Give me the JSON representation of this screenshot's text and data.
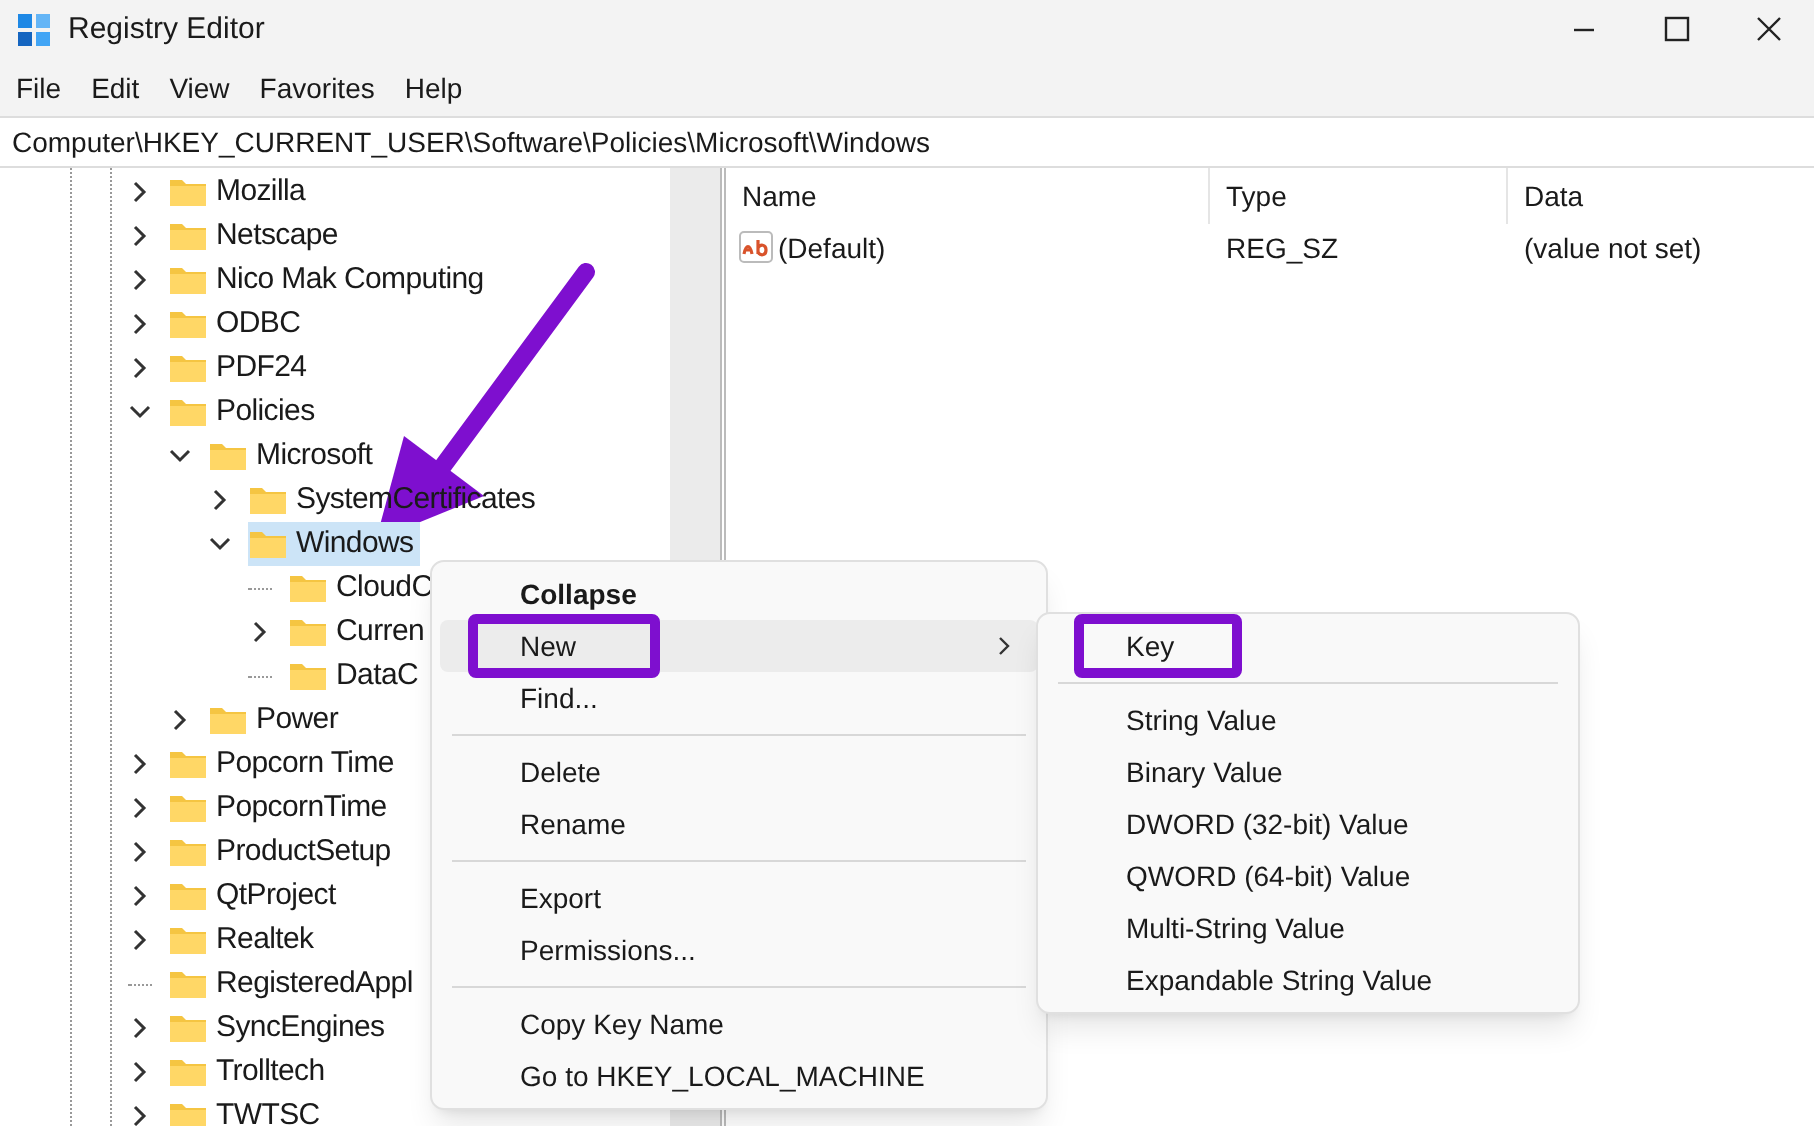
{
  "window": {
    "title": "Registry Editor"
  },
  "menu_bar": [
    "File",
    "Edit",
    "View",
    "Favorites",
    "Help"
  ],
  "address": "Computer\\HKEY_CURRENT_USER\\Software\\Policies\\Microsoft\\Windows",
  "tree": [
    {
      "label": "Mozilla",
      "expandable": true,
      "expanded": false,
      "selected": false
    },
    {
      "label": "Netscape",
      "expandable": true,
      "expanded": false,
      "selected": false
    },
    {
      "label": "Nico Mak Computing",
      "expandable": true,
      "expanded": false,
      "selected": false
    },
    {
      "label": "ODBC",
      "expandable": true,
      "expanded": false,
      "selected": false
    },
    {
      "label": "PDF24",
      "expandable": true,
      "expanded": false,
      "selected": false
    },
    {
      "label": "Policies",
      "expandable": true,
      "expanded": true,
      "selected": false,
      "children": [
        {
          "label": "Microsoft",
          "expandable": true,
          "expanded": true,
          "selected": false,
          "children": [
            {
              "label": "SystemCertificates",
              "expandable": true,
              "expanded": false,
              "selected": false
            },
            {
              "label": "Windows",
              "expandable": true,
              "expanded": true,
              "selected": true,
              "children": [
                {
                  "label": "CloudC",
                  "expandable": false,
                  "selected": false
                },
                {
                  "label": "Curren",
                  "expandable": true,
                  "expanded": false,
                  "selected": false
                },
                {
                  "label": "DataC",
                  "expandable": false,
                  "selected": false
                }
              ]
            }
          ]
        },
        {
          "label": "Power",
          "expandable": true,
          "expanded": false,
          "selected": false
        }
      ]
    },
    {
      "label": "Popcorn Time",
      "expandable": true,
      "expanded": false,
      "selected": false
    },
    {
      "label": "PopcornTime",
      "expandable": true,
      "expanded": false,
      "selected": false
    },
    {
      "label": "ProductSetup",
      "expandable": true,
      "expanded": false,
      "selected": false
    },
    {
      "label": "QtProject",
      "expandable": true,
      "expanded": false,
      "selected": false
    },
    {
      "label": "Realtek",
      "expandable": true,
      "expanded": false,
      "selected": false
    },
    {
      "label": "RegisteredAppl",
      "expandable": false,
      "selected": false
    },
    {
      "label": "SyncEngines",
      "expandable": true,
      "expanded": false,
      "selected": false
    },
    {
      "label": "Trolltech",
      "expandable": true,
      "expanded": false,
      "selected": false
    },
    {
      "label": "TWTSC",
      "expandable": true,
      "expanded": false,
      "selected": false
    }
  ],
  "values": {
    "columns": [
      "Name",
      "Type",
      "Data"
    ],
    "rows": [
      {
        "name": "(Default)",
        "type": "REG_SZ",
        "data": "(value not set)"
      }
    ]
  },
  "context_menu": [
    {
      "kind": "item",
      "label": "Collapse",
      "bold": true,
      "hovered": false,
      "submenu": false,
      "annotated": false
    },
    {
      "kind": "item",
      "label": "New",
      "bold": false,
      "hovered": true,
      "submenu": true,
      "annotated": true
    },
    {
      "kind": "item",
      "label": "Find...",
      "bold": false,
      "hovered": false,
      "submenu": false,
      "annotated": false
    },
    {
      "kind": "separator"
    },
    {
      "kind": "item",
      "label": "Delete",
      "bold": false,
      "hovered": false,
      "submenu": false,
      "annotated": false
    },
    {
      "kind": "item",
      "label": "Rename",
      "bold": false,
      "hovered": false,
      "submenu": false,
      "annotated": false
    },
    {
      "kind": "separator"
    },
    {
      "kind": "item",
      "label": "Export",
      "bold": false,
      "hovered": false,
      "submenu": false,
      "annotated": false
    },
    {
      "kind": "item",
      "label": "Permissions...",
      "bold": false,
      "hovered": false,
      "submenu": false,
      "annotated": false
    },
    {
      "kind": "separator"
    },
    {
      "kind": "item",
      "label": "Copy Key Name",
      "bold": false,
      "hovered": false,
      "submenu": false,
      "annotated": false
    },
    {
      "kind": "item",
      "label": "Go to HKEY_LOCAL_MACHINE",
      "bold": false,
      "hovered": false,
      "submenu": false,
      "annotated": false
    }
  ],
  "submenu": [
    {
      "kind": "item",
      "label": "Key",
      "annotated": true
    },
    {
      "kind": "separator"
    },
    {
      "kind": "item",
      "label": "String Value",
      "annotated": false
    },
    {
      "kind": "item",
      "label": "Binary Value",
      "annotated": false
    },
    {
      "kind": "item",
      "label": "DWORD (32-bit) Value",
      "annotated": false
    },
    {
      "kind": "item",
      "label": "QWORD (64-bit) Value",
      "annotated": false
    },
    {
      "kind": "item",
      "label": "Multi-String Value",
      "annotated": false
    },
    {
      "kind": "item",
      "label": "Expandable String Value",
      "annotated": false
    }
  ],
  "annotation_arrow": {
    "kind": "arrow"
  }
}
